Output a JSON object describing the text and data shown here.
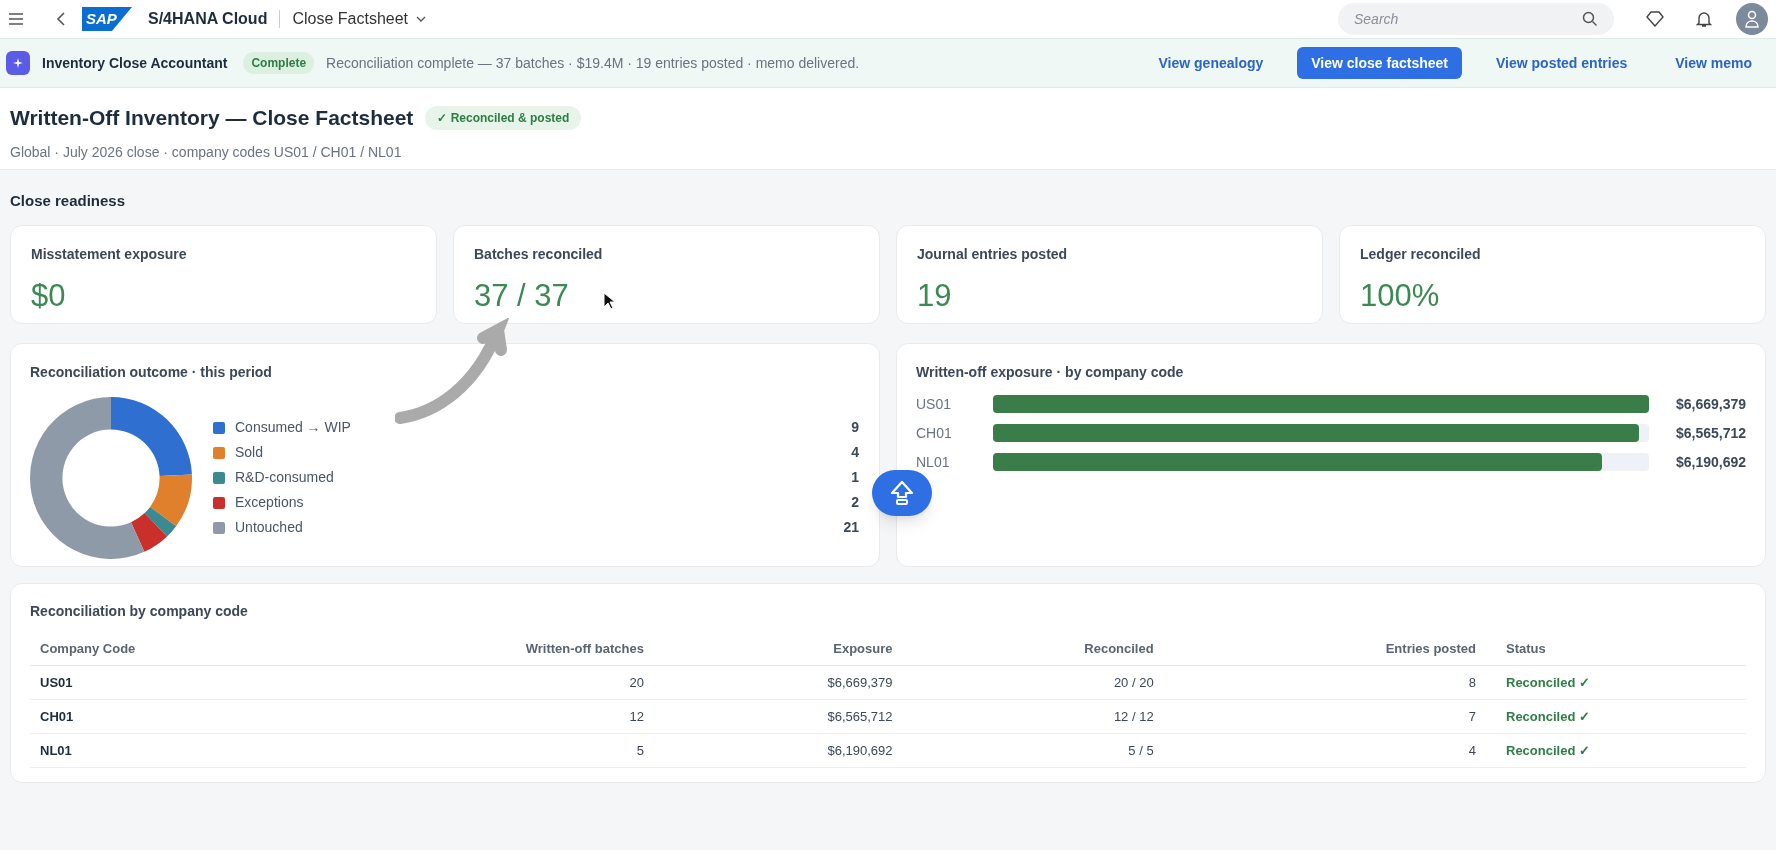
{
  "shell": {
    "logo": "SAP",
    "product": "S/4HANA Cloud",
    "app_title": "Close Factsheet",
    "search": {
      "placeholder": "Search"
    }
  },
  "banner": {
    "agent": "Inventory Close Accountant",
    "badge": "Complete",
    "message": "Reconciliation complete — 37 batches · $19.4M · 19 entries posted · memo delivered.",
    "actions": [
      {
        "label": "View genealogy",
        "selected": false
      },
      {
        "label": "View close factsheet",
        "selected": true
      },
      {
        "label": "View posted entries",
        "selected": false
      },
      {
        "label": "View memo",
        "selected": false
      }
    ]
  },
  "header": {
    "title": "Written-Off Inventory — Close Factsheet",
    "status": "✓ Reconciled & posted",
    "subtitle": "Global · July 2026 close · company codes US01 / CH01 / NL01"
  },
  "section_title": "Close readiness",
  "kpis": [
    {
      "label": "Misstatement exposure",
      "value": "$0"
    },
    {
      "label": "Batches reconciled",
      "value": "37 / 37"
    },
    {
      "label": "Journal entries posted",
      "value": "19"
    },
    {
      "label": "Ledger reconciled",
      "value": "100%"
    }
  ],
  "outcome_card": {
    "title": "Reconciliation outcome · this period",
    "chart_data": {
      "type": "donut",
      "categories": [
        "Consumed → WIP",
        "Sold",
        "R&D-consumed",
        "Exceptions",
        "Untouched"
      ],
      "values": [
        9,
        4,
        1,
        2,
        21
      ],
      "value_labels": [
        "9",
        "4",
        "1",
        "2",
        "21"
      ],
      "colors": [
        "#2f6fd0",
        "#e07f2c",
        "#3a8a90",
        "#c9302c",
        "#8e9aa8"
      ],
      "legend": "right"
    }
  },
  "exposure_card": {
    "title": "Written-off exposure · by company code",
    "chart_data": {
      "type": "bar",
      "orientation": "horizontal",
      "categories": [
        "US01",
        "CH01",
        "NL01"
      ],
      "values": [
        6669379,
        6565712,
        6190692
      ],
      "value_labels": [
        "$6,669,379",
        "$6,565,712",
        "$6,190,692"
      ],
      "color": "#3a7d48"
    }
  },
  "table": {
    "title": "Reconciliation by company code",
    "columns": [
      "Company Code",
      "Written-off batches",
      "Exposure",
      "Reconciled",
      "Entries posted",
      "Status"
    ],
    "rows": [
      [
        "US01",
        "20",
        "$6,669,379",
        "20 / 20",
        "8",
        "Reconciled ✓"
      ],
      [
        "CH01",
        "12",
        "$6,565,712",
        "12 / 12",
        "7",
        "Reconciled ✓"
      ],
      [
        "NL01",
        "5",
        "$6,190,692",
        "5 / 5",
        "4",
        "Reconciled ✓"
      ]
    ]
  }
}
